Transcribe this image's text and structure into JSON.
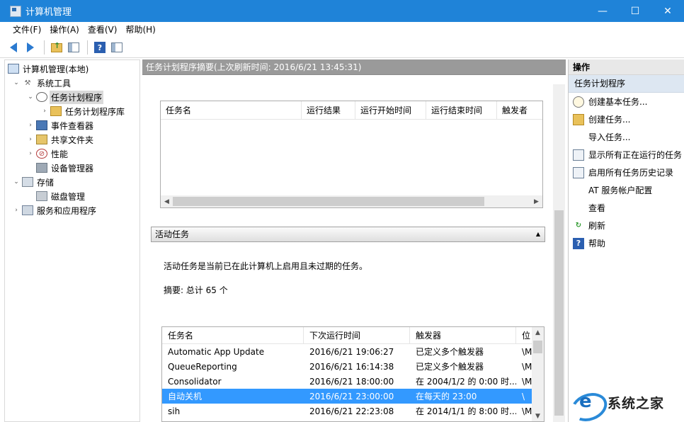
{
  "window": {
    "title": "计算机管理"
  },
  "menu": [
    "文件(F)",
    "操作(A)",
    "查看(V)",
    "帮助(H)"
  ],
  "tree": [
    {
      "label": "计算机管理(本地)",
      "chev": "",
      "icon": "computer-icon",
      "level": 0
    },
    {
      "label": "系统工具",
      "chev": "⌄",
      "icon": "tools-icon",
      "level": 1
    },
    {
      "label": "任务计划程序",
      "chev": "⌄",
      "icon": "clock-icon",
      "level": 2,
      "selected": true
    },
    {
      "label": "任务计划程序库",
      "chev": "›",
      "icon": "folder-icon",
      "level": 3
    },
    {
      "label": "事件查看器",
      "chev": "›",
      "icon": "event-viewer-icon",
      "level": 2
    },
    {
      "label": "共享文件夹",
      "chev": "›",
      "icon": "shared-folder-icon",
      "level": 2
    },
    {
      "label": "性能",
      "chev": "›",
      "icon": "performance-icon",
      "level": 2
    },
    {
      "label": "设备管理器",
      "chev": "",
      "icon": "device-manager-icon",
      "level": 2
    },
    {
      "label": "存储",
      "chev": "⌄",
      "icon": "storage-icon",
      "level": 1
    },
    {
      "label": "磁盘管理",
      "chev": "",
      "icon": "disk-icon",
      "level": 2
    },
    {
      "label": "服务和应用程序",
      "chev": "›",
      "icon": "services-icon",
      "level": 1
    }
  ],
  "middle": {
    "header": "任务计划程序摘要(上次刷新时间: 2016/6/21 13:45:31)",
    "grid1_columns": [
      "任务名",
      "运行结果",
      "运行开始时间",
      "运行结束时间",
      "触发者"
    ],
    "active_tasks": {
      "title": "活动任务",
      "description": "活动任务是当前已在此计算机上启用且未过期的任务。",
      "summary": "摘要: 总计 65 个",
      "columns": [
        "任务名",
        "下次运行时间",
        "触发器",
        "位"
      ],
      "rows": [
        {
          "name": "Automatic App Update",
          "next": "2016/6/21 19:06:27",
          "trigger": "已定义多个触发器",
          "loc": "\\M"
        },
        {
          "name": "QueueReporting",
          "next": "2016/6/21 16:14:38",
          "trigger": "已定义多个触发器",
          "loc": "\\M"
        },
        {
          "name": "Consolidator",
          "next": "2016/6/21 18:00:00",
          "trigger": "在 2004/1/2 的 0:00 时...",
          "loc": "\\M"
        },
        {
          "name": "自动关机",
          "next": "2016/6/21 23:00:00",
          "trigger": "在每天的 23:00",
          "loc": "\\",
          "selected": true
        },
        {
          "name": "sih",
          "next": "2016/6/21 22:23:08",
          "trigger": "在 2014/1/1 的 8:00 时...",
          "loc": "\\M"
        }
      ]
    }
  },
  "actions": {
    "header": "操作",
    "subheader": "任务计划程序",
    "items": [
      {
        "label": "创建基本任务...",
        "icon": "create-basic-task-icon"
      },
      {
        "label": "创建任务...",
        "icon": "create-task-icon"
      },
      {
        "label": "导入任务...",
        "icon": ""
      },
      {
        "label": "显示所有正在运行的任务",
        "icon": "running-tasks-icon"
      },
      {
        "label": "启用所有任务历史记录",
        "icon": "history-icon"
      },
      {
        "label": "AT 服务帐户配置",
        "icon": ""
      },
      {
        "label": "查看",
        "icon": ""
      },
      {
        "label": "刷新",
        "icon": "refresh-icon"
      },
      {
        "label": "帮助",
        "icon": "help-icon"
      }
    ]
  },
  "watermark": {
    "text": "系统之家"
  },
  "colors": {
    "titlebar": "#1f83d8",
    "selection": "#3399ff",
    "header_gray": "#9a9a9a"
  }
}
